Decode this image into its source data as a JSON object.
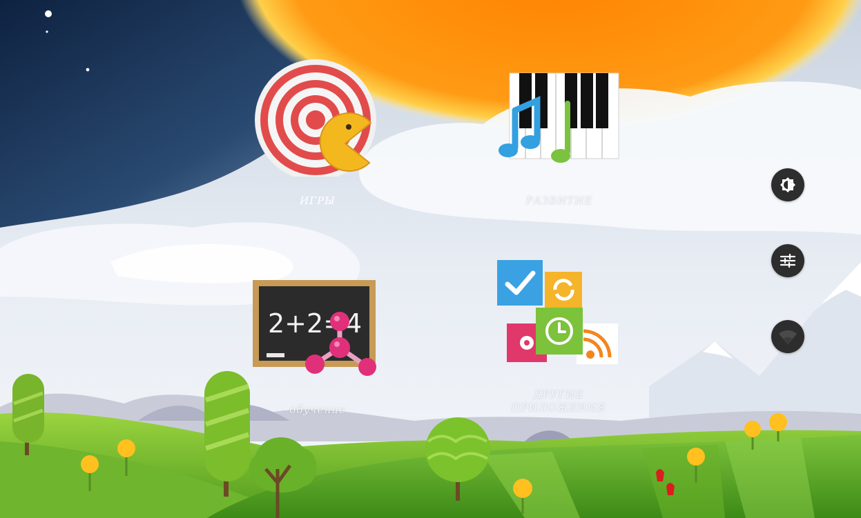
{
  "launcher": {
    "tiles": [
      {
        "label": "ИГРЫ",
        "icon": "target-pacman-icon"
      },
      {
        "label": "РАЗВИТИЕ",
        "icon": "piano-music-icon"
      },
      {
        "label": "обучение",
        "icon": "chalkboard-molecule-icon"
      },
      {
        "label": "ДРУГИЕ\nПРИЛОЖЕНИЯ",
        "icon": "apps-collage-icon"
      }
    ],
    "chalkboard_text": "2+2=4"
  },
  "side_controls": [
    {
      "icon": "brightness-icon"
    },
    {
      "icon": "sliders-icon"
    },
    {
      "icon": "wifi-icon"
    }
  ],
  "colors": {
    "sun": "#ff8c00",
    "night_sky": "#1b3358",
    "grass": "#7cc23b",
    "button_bg": "#2d2d2d"
  }
}
